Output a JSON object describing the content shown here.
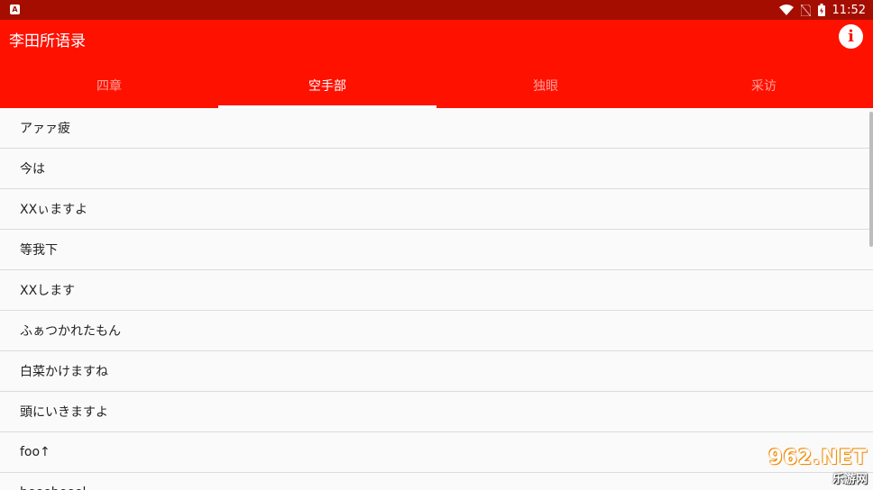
{
  "status_bar": {
    "notification_icon": "A",
    "time": "11:52",
    "icons": [
      "wifi-icon",
      "no-sim-icon",
      "battery-charging-icon"
    ]
  },
  "app_bar": {
    "title": "李田所语录",
    "info_icon": "i"
  },
  "tabs": [
    {
      "label": "四章",
      "active": false
    },
    {
      "label": "空手部",
      "active": true
    },
    {
      "label": "独眼",
      "active": false
    },
    {
      "label": "采访",
      "active": false
    }
  ],
  "list": {
    "items": [
      "アァァ疲",
      "今は",
      "XXぃますよ",
      "等我下",
      "XXします",
      "ふぁつかれたもん",
      "白菜かけますね",
      "頭にいきますよ",
      "foo↑",
      "beeebeeel"
    ]
  },
  "watermark": {
    "top": "962.NET",
    "bottom": "乐游网"
  },
  "colors": {
    "status_bar": "#a50d00",
    "app_bar": "#ff1100",
    "background": "#fafafa"
  }
}
